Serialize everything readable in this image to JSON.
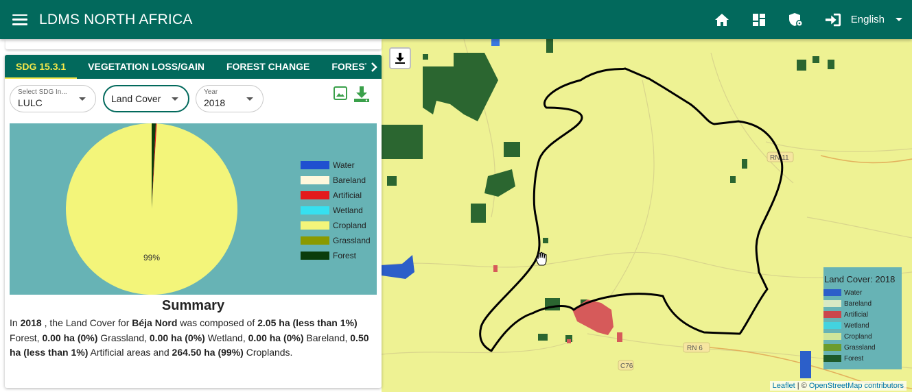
{
  "header": {
    "title": "LDMS NORTH AFRICA",
    "language": "English"
  },
  "tabs": [
    {
      "label": "SDG 15.3.1"
    },
    {
      "label": "VEGETATION LOSS/GAIN"
    },
    {
      "label": "FOREST CHANGE"
    },
    {
      "label": "FOREST FIRE"
    }
  ],
  "controls": {
    "indicator": {
      "label": "Select SDG In...",
      "value": "LULC"
    },
    "layer": {
      "value": "Land Cover"
    },
    "year": {
      "label": "Year",
      "value": "2018"
    }
  },
  "chart_data": {
    "type": "pie",
    "title": "",
    "slices": [
      {
        "label": "Water",
        "value": 0.0,
        "color": "#1f4fd0"
      },
      {
        "label": "Bareland",
        "value": 0.0,
        "color": "#fff8dc"
      },
      {
        "label": "Artificial",
        "value": 0.5,
        "color": "#e31a1c"
      },
      {
        "label": "Wetland",
        "value": 0.0,
        "color": "#36e0f0"
      },
      {
        "label": "Cropland",
        "value": 264.5,
        "color": "#f3f57a"
      },
      {
        "label": "Grassland",
        "value": 0.0,
        "color": "#8a9a00"
      },
      {
        "label": "Forest",
        "value": 2.05,
        "color": "#0b3d0b"
      }
    ],
    "data_labels": [
      {
        "slice": "Cropland",
        "text": "99%"
      }
    ],
    "legend_position": "right",
    "background": "#67b3b5"
  },
  "summary": {
    "title": "Summary",
    "year": "2018",
    "region": "Béja Nord",
    "t1": "In ",
    "t2": " , the Land Cover for ",
    "t3": " was composed of ",
    "forest": "2.05 ha (less than 1%)",
    "t4": " Forest, ",
    "grassland": "0.00 ha (0%)",
    "t5": " Grassland, ",
    "wetland": "0.00 ha (0%)",
    "t6": " Wetland, ",
    "bareland": "0.00 ha (0%)",
    "t7": " Bareland, ",
    "artificial": "0.50 ha (less than 1%)",
    "t8": " Artificial areas and ",
    "cropland": "264.50 ha (99%)",
    "t9": " Croplands."
  },
  "map": {
    "legend_title": "Land Cover: 2018",
    "legend_items": [
      {
        "label": "Water",
        "color": "#2c5fc9"
      },
      {
        "label": "Bareland",
        "color": "#d8e9c4"
      },
      {
        "label": "Artificial",
        "color": "#c9474d"
      },
      {
        "label": "Wetland",
        "color": "#43d3df"
      },
      {
        "label": "Cropland",
        "color": "#cfe59a"
      },
      {
        "label": "Grassland",
        "color": "#6c9c2e"
      },
      {
        "label": "Forest",
        "color": "#1d5a2a"
      }
    ],
    "road_labels": [
      "RN 11",
      "RN 6",
      "C76"
    ],
    "attribution_leaflet": "Leaflet",
    "attribution_sep": " | © ",
    "attribution_osm": "OpenStreetMap contributors"
  },
  "colors": {
    "primary": "#02695c",
    "tab_active": "#f5e84a",
    "map_base": "#eef293",
    "boundary": "#000000"
  }
}
